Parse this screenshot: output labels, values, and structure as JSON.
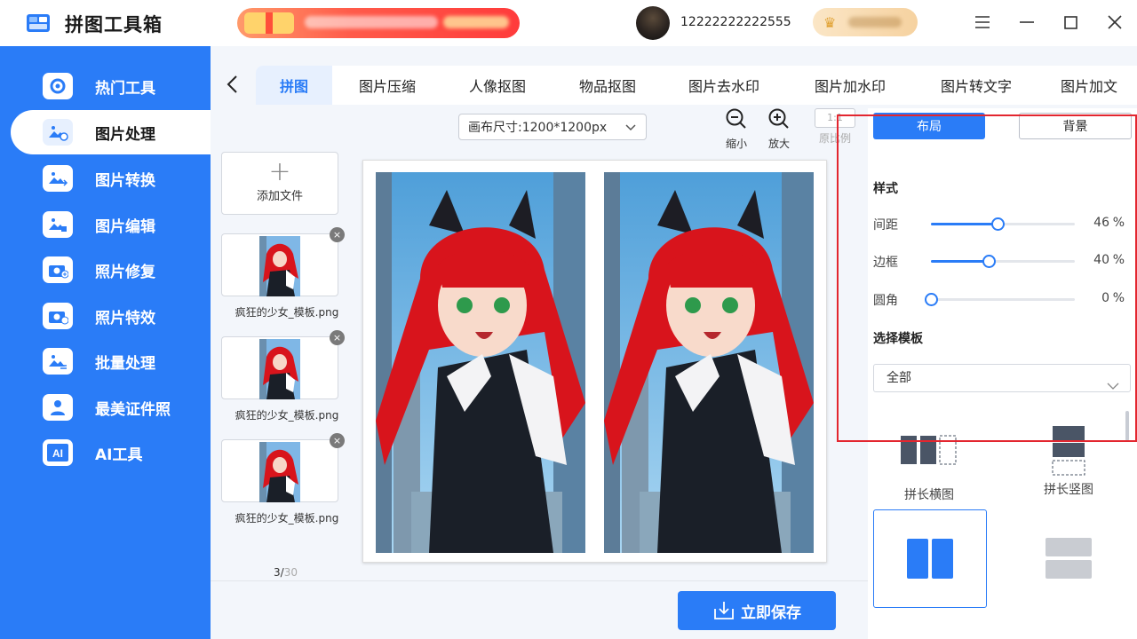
{
  "app": {
    "title": "拼图工具箱",
    "username": "12222222222555"
  },
  "sidebar": {
    "items": [
      {
        "label": "热门工具"
      },
      {
        "label": "图片处理"
      },
      {
        "label": "图片转换"
      },
      {
        "label": "图片编辑"
      },
      {
        "label": "照片修复"
      },
      {
        "label": "照片特效"
      },
      {
        "label": "批量处理"
      },
      {
        "label": "最美证件照"
      },
      {
        "label": "AI工具"
      }
    ],
    "active_index": 1
  },
  "tabs": [
    {
      "label": "拼图"
    },
    {
      "label": "图片压缩"
    },
    {
      "label": "人像抠图"
    },
    {
      "label": "物品抠图"
    },
    {
      "label": "图片去水印"
    },
    {
      "label": "图片加水印"
    },
    {
      "label": "图片转文字"
    },
    {
      "label": "图片加文"
    }
  ],
  "toolbar": {
    "canvas_size": "画布尺寸:1200*1200px",
    "zoom_out": "缩小",
    "zoom_in": "放大",
    "ratio_box": "1:1",
    "ratio": "原比例"
  },
  "files": {
    "add_label": "添加文件",
    "items": [
      {
        "name": "疯狂的少女_模板.png"
      },
      {
        "name": "疯狂的少女_模板.png"
      },
      {
        "name": "疯狂的少女_模板.png"
      }
    ],
    "count_current": "3/",
    "count_total": "30"
  },
  "save_label": "立即保存",
  "panel": {
    "tab_layout": "布局",
    "tab_background": "背景",
    "style_title": "样式",
    "sliders": [
      {
        "label": "间距",
        "value": 46,
        "unit": "%"
      },
      {
        "label": "边框",
        "value": 40,
        "unit": "%"
      },
      {
        "label": "圆角",
        "value": 0,
        "unit": "%"
      }
    ],
    "template_title": "选择模板",
    "template_select": "全部",
    "templates": [
      {
        "label": "拼长横图"
      },
      {
        "label": "拼长竖图"
      }
    ]
  },
  "colors": {
    "accent": "#2a7cf7",
    "highlight": "#e3262f"
  }
}
